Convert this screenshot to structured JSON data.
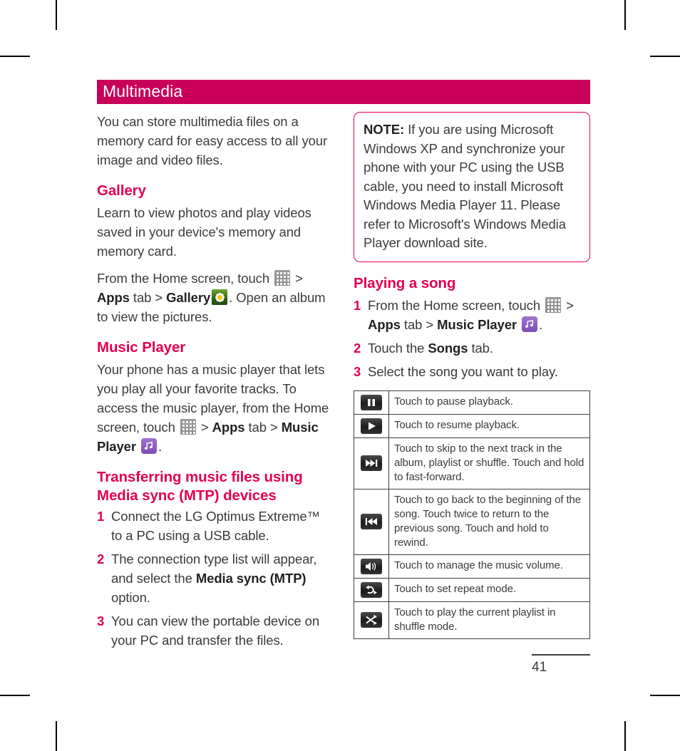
{
  "chapter": {
    "title": "Multimedia",
    "bar_color": "#c8005a",
    "heading_color": "#e3004f"
  },
  "left_column": {
    "intro": "You can store multimedia files on a memory card for easy access to all your image and video files.",
    "gallery": {
      "heading": "Gallery",
      "p1": "Learn to view photos and play videos saved in your device's memory and memory card.",
      "p2_a": "From the Home screen, touch ",
      "p2_b": " > ",
      "p2_apps": "Apps",
      "p2_c": " tab > ",
      "p2_gallery": "Gallery",
      "p2_d": ". Open an album to view the pictures."
    },
    "music_player": {
      "heading": "Music Player",
      "p1_a": "Your phone has a music player that lets you play all your favorite tracks. To access the music player, from the Home screen, touch ",
      "p1_b": " > ",
      "p1_apps": "Apps",
      "p1_c": " tab > ",
      "p1_label": "Music Player",
      "p1_d": "."
    },
    "transferring": {
      "heading": "Transferring music files using Media sync (MTP) devices",
      "steps": [
        {
          "num": "1",
          "text": "Connect the LG Optimus Extreme™ to a PC using a USB cable."
        },
        {
          "num": "2",
          "text_a": "The connection type list will appear, and select the ",
          "bold": "Media sync (MTP)",
          "text_b": " option."
        },
        {
          "num": "3",
          "text": "You can view the portable device on your PC and transfer the files."
        }
      ]
    }
  },
  "right_column": {
    "note": {
      "label": "NOTE:",
      "text": " If you are using Microsoft Windows XP and synchronize your phone with your PC using the USB cable, you need to install Microsoft Windows Media Player 11. Please refer to Microsoft's Windows Media Player download site."
    },
    "playing": {
      "heading": "Playing a song",
      "steps": [
        {
          "num": "1",
          "text_a": "From the Home screen, touch ",
          "text_b": " > ",
          "apps": "Apps",
          "text_c": " tab > ",
          "music": "Music Player",
          "text_d": "."
        },
        {
          "num": "2",
          "text_a": "Touch the ",
          "bold": "Songs",
          "text_b": " tab."
        },
        {
          "num": "3",
          "text": "Select the song you want to play."
        }
      ]
    },
    "controls_table": {
      "rows": [
        {
          "icon": "pause-icon",
          "desc": "Touch to pause playback."
        },
        {
          "icon": "play-icon",
          "desc": "Touch to resume playback."
        },
        {
          "icon": "next-track-icon",
          "desc": "Touch to skip to the next track in the album, playlist or shuffle. Touch and hold to fast-forward."
        },
        {
          "icon": "previous-track-icon",
          "desc": "Touch to go back to the beginning of the song. Touch twice to return to the previous song. Touch and hold to rewind."
        },
        {
          "icon": "volume-icon",
          "desc": "Touch to manage the music volume."
        },
        {
          "icon": "repeat-icon",
          "desc": "Touch to set repeat mode."
        },
        {
          "icon": "shuffle-icon",
          "desc": "Touch to play the current playlist in shuffle mode."
        }
      ]
    }
  },
  "footer": {
    "page_number": "41"
  }
}
